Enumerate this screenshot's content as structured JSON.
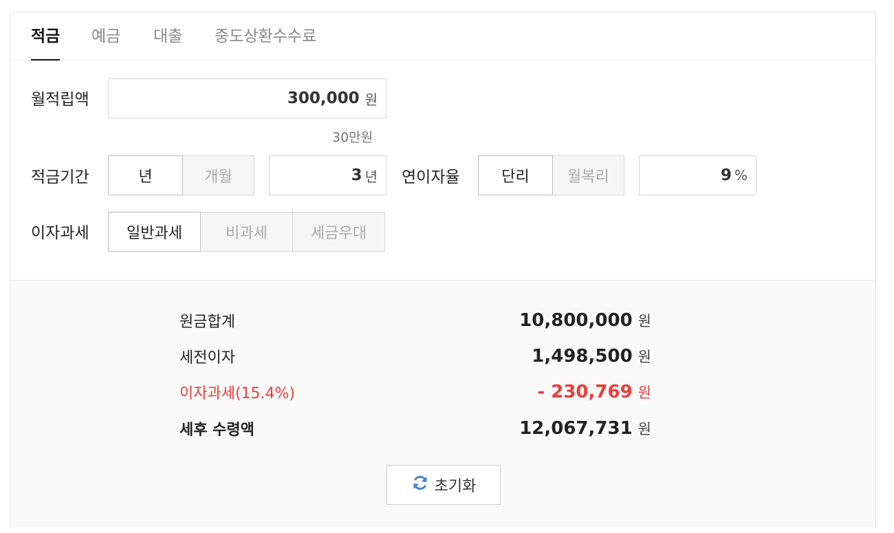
{
  "tabs": [
    {
      "label": "적금",
      "active": true
    },
    {
      "label": "예금",
      "active": false
    },
    {
      "label": "대출",
      "active": false
    },
    {
      "label": "중도상환수수료",
      "active": false
    }
  ],
  "monthly": {
    "label": "월적립액",
    "value": "300,000",
    "unit": "원",
    "hint": "30만원"
  },
  "period": {
    "label": "적금기간",
    "options": [
      "년",
      "개월"
    ],
    "selected": "년",
    "value": "3",
    "unit": "년"
  },
  "rate": {
    "label": "연이자율",
    "options": [
      "단리",
      "월복리"
    ],
    "selected": "단리",
    "value": "9",
    "unit": "%"
  },
  "tax": {
    "label": "이자과세",
    "options": [
      "일반과세",
      "비과세",
      "세금우대"
    ],
    "selected": "일반과세"
  },
  "results": [
    {
      "label": "원금합계",
      "value": "10,800,000",
      "unit": "원"
    },
    {
      "label": "세전이자",
      "value": "1,498,500",
      "unit": "원"
    },
    {
      "label": "이자과세(15.4%)",
      "value": "- 230,769",
      "unit": "원"
    },
    {
      "label": "세후 수령액",
      "value": "12,067,731",
      "unit": "원"
    }
  ],
  "reset": {
    "label": "초기화",
    "icon": "refresh-icon"
  },
  "colors": {
    "accent_red": "#ee3b3b",
    "icon_blue": "#3b82d8"
  }
}
